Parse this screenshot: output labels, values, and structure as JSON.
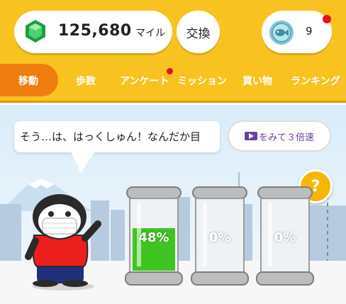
{
  "header": {
    "miles_value": "125,680",
    "miles_unit": "マイル",
    "exchange_label": "交換",
    "tickets_count": "9"
  },
  "tabs": [
    {
      "label": "移動",
      "active": true
    },
    {
      "label": "歩数"
    },
    {
      "label": "アンケート",
      "badge": true
    },
    {
      "label": "ミッション"
    },
    {
      "label": "買い物"
    },
    {
      "label": "ランキング"
    }
  ],
  "scene": {
    "bubble_text": "そう…は、はっくしゅん！なんだか目",
    "speed_button_label": "をみて３倍速",
    "help_label": "?",
    "jars": [
      {
        "percent_label": "48%",
        "fill": 0.48,
        "color": "#3fc51f"
      },
      {
        "percent_label": "0%",
        "fill": 0
      },
      {
        "percent_label": "0%",
        "fill": 0
      }
    ]
  },
  "colors": {
    "brand_yellow": "#f8c320",
    "active_tab": "#f07d0f",
    "badge_red": "#e8101f",
    "speed_purple": "#6a3fa8"
  }
}
